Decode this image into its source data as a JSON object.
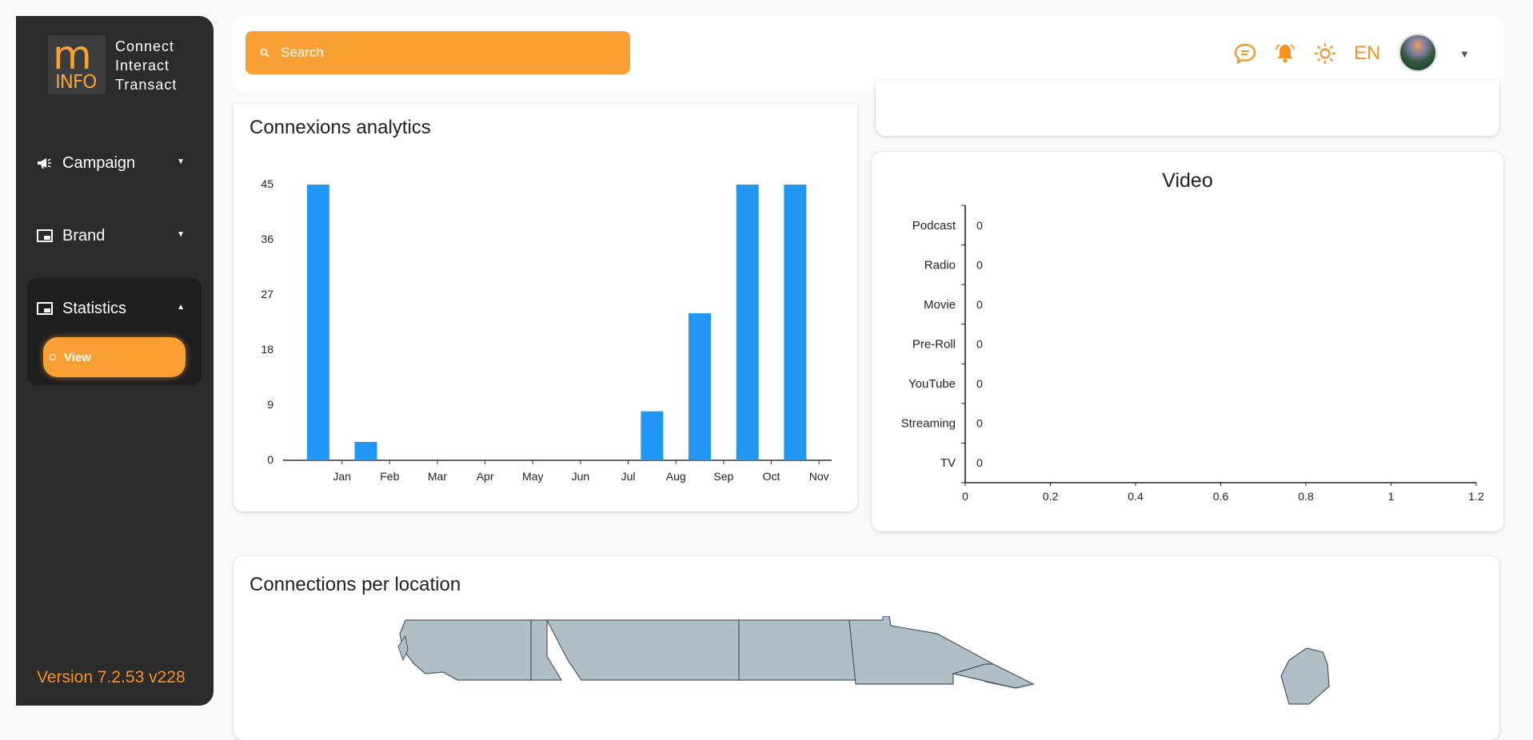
{
  "brand": {
    "logo_mark": "m",
    "logo_sub": "INFO",
    "tagline": [
      "Connect",
      "Interact",
      "Transact"
    ]
  },
  "sidebar": {
    "items": [
      {
        "label": "Campaign",
        "icon": "megaphone-icon"
      },
      {
        "label": "Brand",
        "icon": "picture-in-picture-icon"
      },
      {
        "label": "Statistics",
        "icon": "picture-in-picture-icon"
      }
    ],
    "sub_item": {
      "label": "View"
    },
    "version": "Version 7.2.53 v228"
  },
  "topbar": {
    "search_placeholder": "Search",
    "language": "EN",
    "icons": [
      "chat-icon",
      "bell-icon",
      "sun-icon"
    ]
  },
  "colors": {
    "accent": "#f9a035",
    "bar": "#2196f3",
    "sidebar": "#2b2b2b"
  },
  "connexions": {
    "title": "Connexions analytics",
    "chart_data": {
      "type": "bar",
      "categories": [
        "Jan",
        "Feb",
        "Mar",
        "Apr",
        "May",
        "Jun",
        "Jul",
        "Aug",
        "Sep",
        "Oct",
        "Nov"
      ],
      "values": [
        45,
        3,
        0,
        0,
        0,
        0,
        0,
        8,
        24,
        45,
        45
      ],
      "ylim": [
        0,
        45
      ],
      "yticks": [
        0,
        9,
        18,
        27,
        36,
        45
      ]
    }
  },
  "video": {
    "title": "Video",
    "chart_data": {
      "type": "bar",
      "orientation": "horizontal",
      "categories": [
        "Podcast",
        "Radio",
        "Movie",
        "Pre-Roll",
        "YouTube",
        "Streaming",
        "TV"
      ],
      "values": [
        0,
        0,
        0,
        0,
        0,
        0,
        0
      ],
      "xlim": [
        0,
        1.2
      ],
      "xticks": [
        "0",
        "0.2",
        "0.4",
        "0.6",
        "0.8",
        "1",
        "1.2"
      ]
    }
  },
  "location": {
    "title": "Connections per location"
  }
}
